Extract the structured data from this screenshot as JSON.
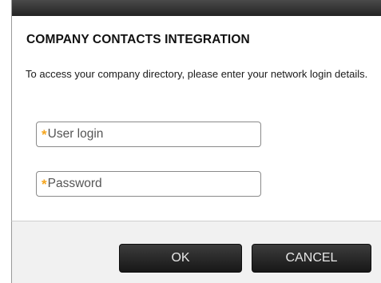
{
  "dialog": {
    "title": "COMPANY CONTACTS INTEGRATION",
    "description": "To access your company directory, please enter your network login details."
  },
  "form": {
    "required_marker": "*",
    "login_placeholder": "User login",
    "password_placeholder": "Password"
  },
  "buttons": {
    "ok_label": "OK",
    "cancel_label": "CANCEL"
  },
  "colors": {
    "required_star": "#f5a51c",
    "button_bg": "#232323",
    "button_text": "#e8e8e8"
  }
}
